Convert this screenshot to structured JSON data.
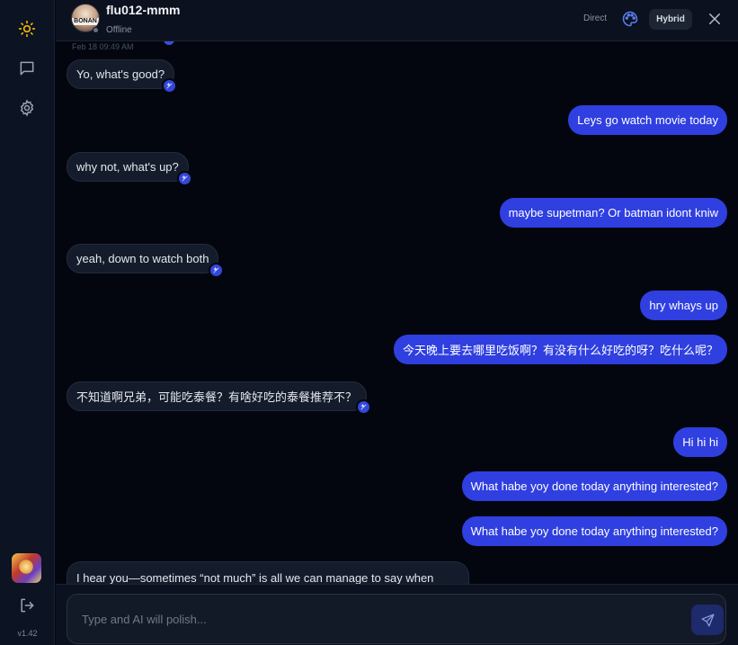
{
  "sidebar": {
    "icons": [
      "sun-icon",
      "chat-icon",
      "gear-icon"
    ],
    "version": "v1.42",
    "logout_icon": "logout-icon"
  },
  "header": {
    "contact_name": "flu012-mmm",
    "status": "Offline",
    "avatar_text": "BONAN",
    "mode_direct": "Direct",
    "mode_hybrid": "Hybrid",
    "active_mode": "Hybrid"
  },
  "chat": {
    "timestamp": "Feb 18 09:49 AM",
    "messages": [
      {
        "side": "in",
        "text": "Yo, what's good?",
        "ai": true
      },
      {
        "side": "out",
        "text": "Leys go watch movie today"
      },
      {
        "side": "in",
        "text": "why not, what's up?",
        "ai": true
      },
      {
        "side": "out",
        "text": "maybe supetman? Or batman idont kniw"
      },
      {
        "side": "in",
        "text": "yeah, down to watch both",
        "ai": true
      },
      {
        "side": "out",
        "text": "hry whays up"
      },
      {
        "side": "out",
        "text": "今天晚上要去哪里吃饭啊？有没有什么好吃的呀？吃什么呢？"
      },
      {
        "side": "in",
        "text": "不知道啊兄弟，可能吃泰餐？有啥好吃的泰餐推荐不？",
        "ai": true
      },
      {
        "side": "out",
        "text": "Hi hi hi"
      },
      {
        "side": "out",
        "text": "What habe yoy done today anything interested?"
      },
      {
        "side": "out",
        "text": "What habe yoy done today anything interested?"
      },
      {
        "side": "in",
        "text": "I hear you—sometimes “not much” is all we can manage to say when",
        "ai": false
      }
    ]
  },
  "composer": {
    "placeholder": "Type and AI will polish...",
    "value": ""
  },
  "colors": {
    "outgoing_bubble": "#2f3fe0",
    "incoming_bubble": "#141c2b",
    "accent_sun": "#f5b400",
    "background": "#04060f"
  }
}
